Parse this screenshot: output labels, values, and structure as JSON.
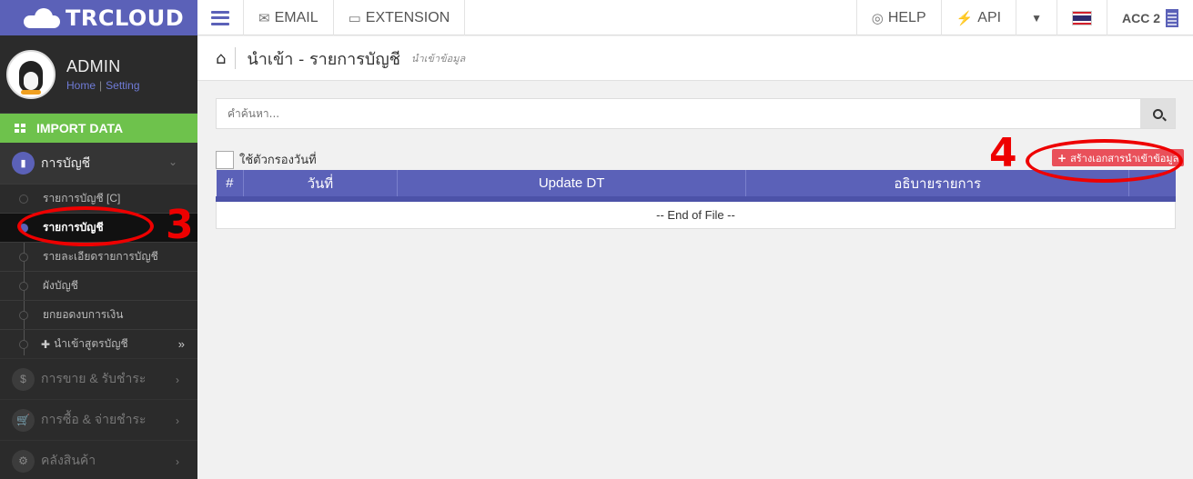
{
  "app": {
    "brand": "TRCLOUD"
  },
  "topbar": {
    "email_label": "EMAIL",
    "extension_label": "EXTENSION",
    "help_label": "HELP",
    "api_label": "API",
    "account_label": "ACC 2"
  },
  "sidebar": {
    "user_name": "ADMIN",
    "home_link": "Home",
    "link_sep": "|",
    "setting_link": "Setting",
    "import_label": "IMPORT DATA",
    "section_label": "การบัญชี",
    "items": [
      {
        "label": "รายการบัญชี [C]"
      },
      {
        "label": "รายการบัญชี"
      },
      {
        "label": "รายละเอียดรายการบัญชี"
      },
      {
        "label": "ผังบัญชี"
      },
      {
        "label": "ยกยอดงบการเงิน"
      },
      {
        "label": "นำเข้าสูตรบัญชี"
      }
    ],
    "more_sections": [
      {
        "label": "การขาย & รับชำระ",
        "icon_text": "$"
      },
      {
        "label": "การซื้อ & จ่ายชำระ",
        "icon_text": "🛒"
      },
      {
        "label": "คลังสินค้า",
        "icon_text": "⚙"
      }
    ]
  },
  "page": {
    "title": "นำเข้า - รายการบัญชี",
    "subtitle": "นำเข้าข้อมูล",
    "search_placeholder": "คำค้นหา...",
    "filter_label": "ใช้ตัวกรองวันที่",
    "create_button_label": "สร้างเอกสารนำเข้าข้อมูล"
  },
  "table": {
    "headers": [
      "#",
      "วันที่",
      "Update DT",
      "อธิบายรายการ",
      ""
    ],
    "empty_row": "-- End of File --"
  },
  "annotations": {
    "step3": "3",
    "step4": "4",
    "color": "#e00000"
  },
  "colors": {
    "accent": "#5b61b8",
    "import_green": "#6ec24c",
    "create_red": "#e9505a",
    "sidebar_bg": "#2b2b2b"
  }
}
